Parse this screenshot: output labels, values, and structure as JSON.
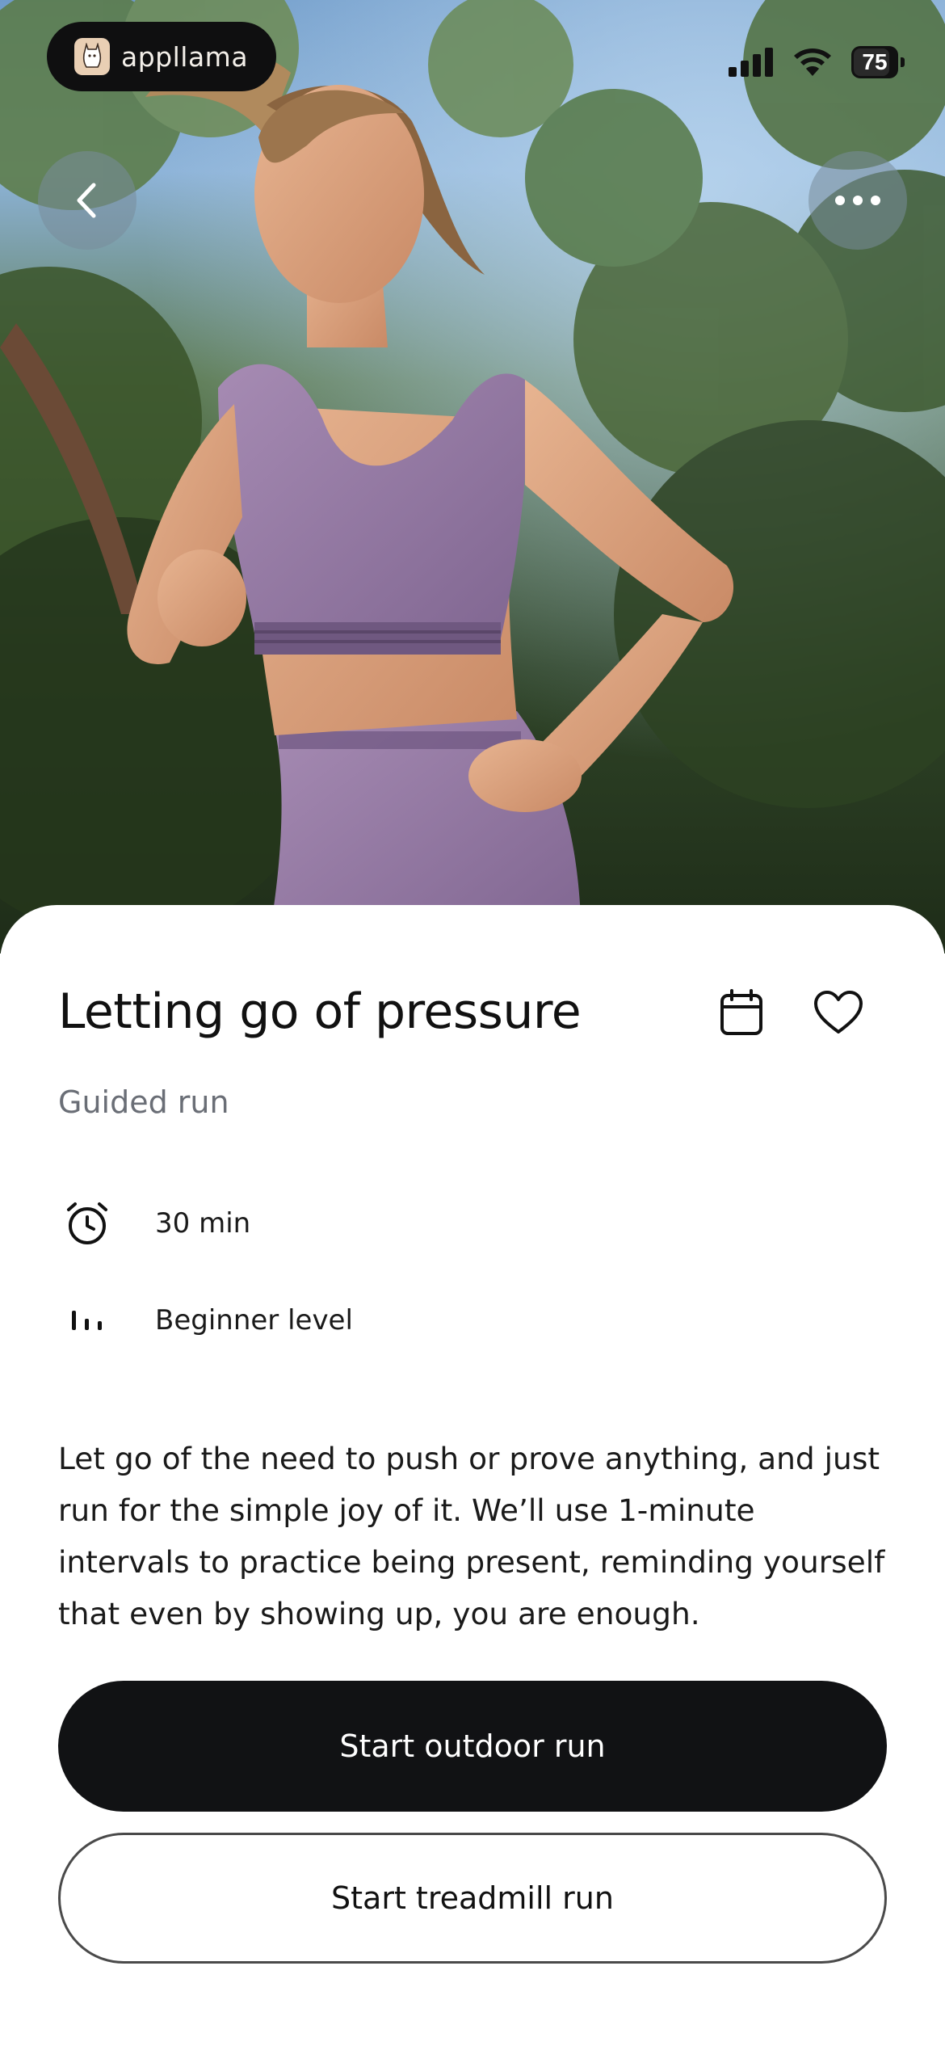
{
  "status_bar": {
    "app_name": "appllama",
    "battery_level": "75",
    "icons": [
      "cellular-signal-icon",
      "wifi-icon",
      "battery-icon"
    ]
  },
  "hero": {
    "image_alt": "Woman in a lilac sports bra and leggings running outdoors among trees",
    "back_icon": "chevron-left-icon",
    "more_icon": "more-dots-icon"
  },
  "workout": {
    "title": "Letting go of pressure",
    "type": "Guided run",
    "duration": "30 min",
    "level": "Beginner level",
    "description": "Let go of the need to push or prove anything, and just run for the simple joy of it. We’ll use 1-minute intervals to practice being present, reminding yourself that even by showing up, you are enough."
  },
  "actions": {
    "primary_label": "Start outdoor run",
    "secondary_label": "Start treadmill run"
  },
  "colors": {
    "primary_button": "#111214",
    "subtitle_text": "#6a6e76",
    "outfit": "#9b7fa8"
  }
}
